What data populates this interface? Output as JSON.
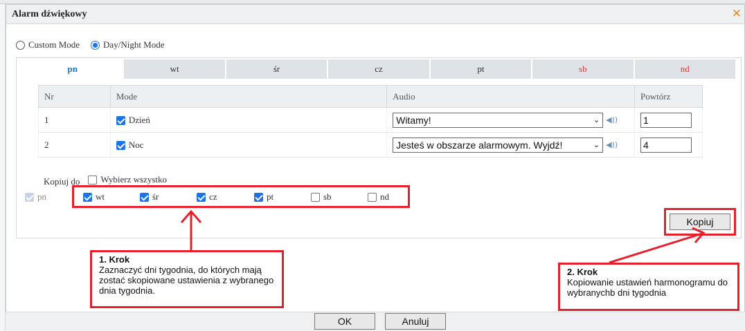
{
  "dialog": {
    "title": "Alarm dźwiękowy",
    "close_glyph": "✕"
  },
  "modes": {
    "options": [
      {
        "label": "Custom Mode",
        "selected": false
      },
      {
        "label": "Day/Night Mode",
        "selected": true
      }
    ]
  },
  "tabs": [
    {
      "label": "pn",
      "active": true
    },
    {
      "label": "wt"
    },
    {
      "label": "śr"
    },
    {
      "label": "cz"
    },
    {
      "label": "pt"
    },
    {
      "label": "sb",
      "weekend": true
    },
    {
      "label": "nd",
      "weekend": true
    }
  ],
  "table": {
    "headers": {
      "nr": "Nr",
      "mode": "Mode",
      "audio": "Audio",
      "repeat": "Powtórz"
    },
    "rows": [
      {
        "nr": "1",
        "mode": "Dzień",
        "mode_checked": true,
        "audio": "Witamy!",
        "repeat": "1"
      },
      {
        "nr": "2",
        "mode": "Noc",
        "mode_checked": true,
        "audio": "Jesteś w obszarze alarmowym. Wyjdź!",
        "repeat": "4"
      }
    ]
  },
  "copy": {
    "label": "Kopiuj do",
    "select_all": "Wybierz wszystko",
    "source_day": "pn",
    "days": [
      {
        "label": "wt",
        "checked": true
      },
      {
        "label": "śr",
        "checked": true
      },
      {
        "label": "cz",
        "checked": true
      },
      {
        "label": "pt",
        "checked": true
      },
      {
        "label": "sb",
        "checked": false
      },
      {
        "label": "nd",
        "checked": false
      }
    ],
    "button": "Kopiuj"
  },
  "callouts": {
    "step1": {
      "heading": "1. Krok",
      "text": "Zaznaczyć dni tygodnia, do których mają zostać skopiowane ustawienia z wybranego dnia tygodnia."
    },
    "step2": {
      "heading": "2. Krok",
      "text": "Kopiowanie ustawień harmonogramu do wybranychb dni tygodnia"
    }
  },
  "footer": {
    "ok": "OK",
    "cancel": "Anuluj"
  },
  "colors": {
    "accent": "#1a73e8",
    "annotation_red": "#e5202b",
    "weekend": "#d93a3a",
    "active_tab": "#1f6fb2"
  }
}
